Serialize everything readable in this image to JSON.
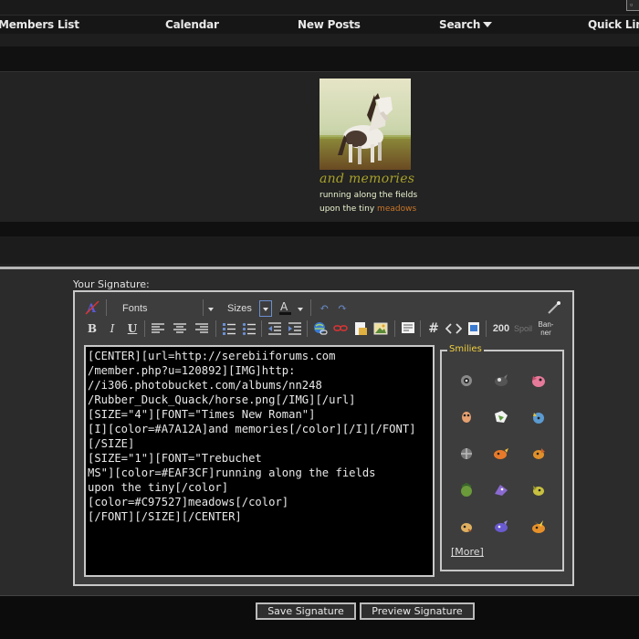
{
  "nav": {
    "items": [
      "Members List",
      "Calendar",
      "New Posts",
      "Search",
      "Quick Links"
    ]
  },
  "signature_preview": {
    "caption": "and memories",
    "line1": "running along the fields",
    "line2_prefix": "upon the tiny ",
    "line2_highlight": "meadows",
    "colors": {
      "caption": "#A7A12A",
      "text": "#EAF3CF",
      "highlight": "#C97527"
    }
  },
  "editor": {
    "section_label": "Your Signature:",
    "font_select": "Fonts",
    "size_select": "Sizes",
    "toolbar_extra": {
      "counter": "200",
      "spoil": "Spoil",
      "banner": "Ban-ner"
    },
    "content": "[CENTER][url=http://serebiiforums.com\n/member.php?u=120892][IMG]http:\n//i306.photobucket.com/albums/nn248\n/Rubber_Duck_Quack/horse.png[/IMG][/url]\n[SIZE=\"4\"][FONT=\"Times New Roman\"]\n[I][color=#A7A12A]and memories[/color][/I][/FONT]\n[/SIZE]\n[SIZE=\"1\"][FONT=\"Trebuchet\nMS\"][color=#EAF3CF]running along the fields\nupon the tiny[/color] [color=#C97527]meadows[/color]\n[/FONT][/SIZE][/CENTER]",
    "smilies_title": "Smilies",
    "more_link": "[More]"
  },
  "buttons": {
    "save": "Save Signature",
    "preview": "Preview Signature"
  }
}
